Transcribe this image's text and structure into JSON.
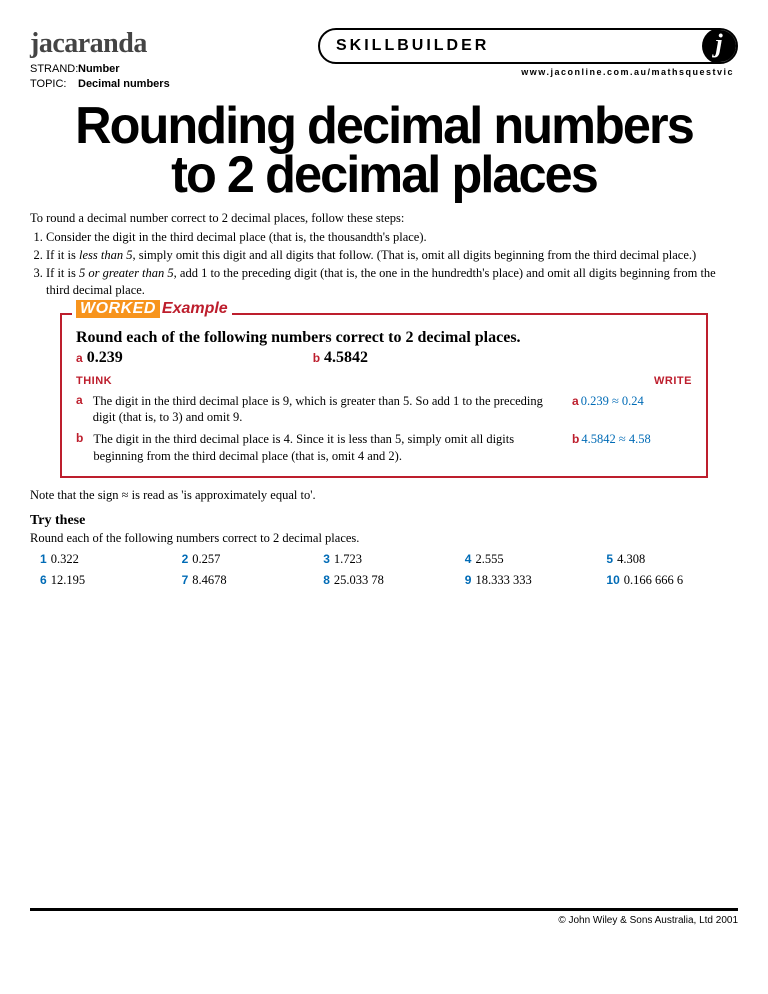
{
  "brand": "jacaranda",
  "strand_label": "STRAND:",
  "strand_value": "Number",
  "topic_label": "TOPIC:",
  "topic_value": "Decimal numbers",
  "skill_title": "SKILLBUILDER",
  "skill_url": "www.jaconline.com.au/mathsquestvic",
  "skill_icon": "j",
  "page_title_l1": "Rounding decimal numbers",
  "page_title_l2": "to 2 decimal places",
  "intro_lead": "To round a decimal number correct to 2 decimal places, follow these steps:",
  "steps": [
    "Consider the digit in the third decimal place (that is, the thousandth's place).",
    "If it is <span class='em'>less than 5</span>, simply omit this digit and all digits that follow. (That is, omit all digits beginning from the third decimal place.)",
    "If it is <span class='em'>5 or greater than 5</span>, add 1 to the preceding digit (that is, the one in the hundredth's place) and omit all digits beginning from the third decimal place."
  ],
  "worked_badge_1": "WORKED",
  "worked_badge_2": "Example",
  "worked_instr": "Round each of the following numbers correct to 2 decimal places.",
  "worked_a_val": "0.239",
  "worked_b_val": "4.5842",
  "think_label": "THINK",
  "write_label": "WRITE",
  "lbl_a": "a",
  "lbl_b": "b",
  "think_a": "The digit in the third decimal place is 9, which is greater than 5. So add 1 to the preceding digit (that is, to 3) and omit 9.",
  "write_a": "0.239 ≈ 0.24",
  "think_b": "The digit in the third decimal place is 4. Since it is less than 5, simply omit all digits beginning from the third decimal place (that is, omit 4 and 2).",
  "write_b": "4.5842 ≈ 4.58",
  "note": "Note that the sign ≈ is read as 'is approximately equal to'.",
  "try_title": "Try these",
  "try_instr": "Round each of the following numbers correct to 2 decimal places.",
  "try_items": [
    {
      "n": "1",
      "v": "0.322"
    },
    {
      "n": "2",
      "v": "0.257"
    },
    {
      "n": "3",
      "v": "1.723"
    },
    {
      "n": "4",
      "v": "2.555"
    },
    {
      "n": "5",
      "v": "4.308"
    },
    {
      "n": "6",
      "v": "12.195"
    },
    {
      "n": "7",
      "v": "8.4678"
    },
    {
      "n": "8",
      "v": "25.033 78"
    },
    {
      "n": "9",
      "v": "18.333 333"
    },
    {
      "n": "10",
      "v": "0.166 666 6"
    }
  ],
  "copyright": "© John Wiley & Sons Australia, Ltd 2001"
}
